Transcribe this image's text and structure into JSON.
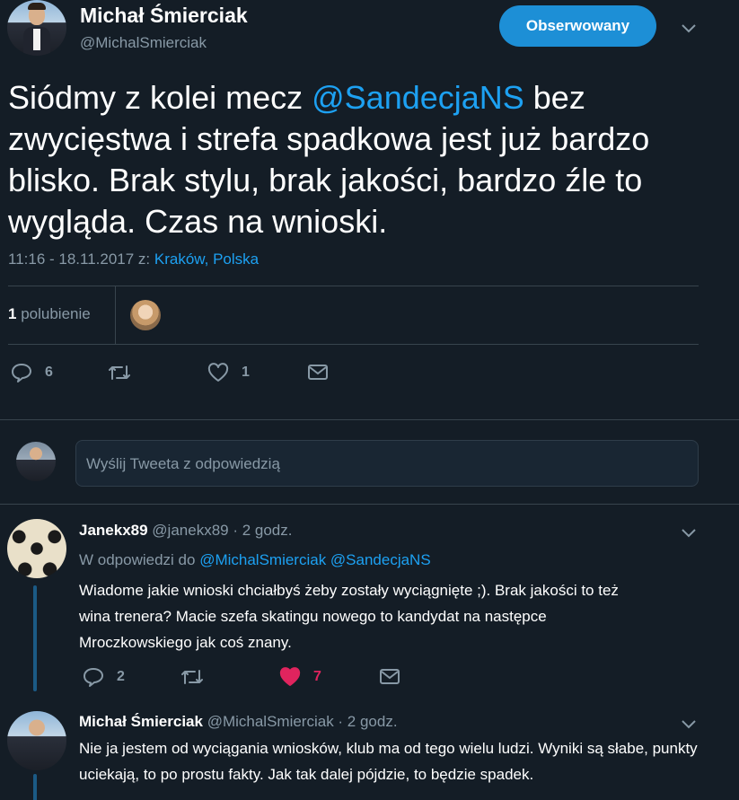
{
  "main_tweet": {
    "author_name": "Michał Śmierciak",
    "author_handle": "@MichalSmierciak",
    "follow_label": "Obserwowany",
    "text_before": "Siódmy z kolei mecz ",
    "mention": "@SandecjaNS",
    "text_after": " bez zwycięstwa i strefa spadkowa jest już bardzo blisko. Brak stylu, brak jakości, bardzo źle to wygląda. Czas na wnioski.",
    "timestamp": "11:16 - 18.11.2017 z: ",
    "location": "Kraków, Polska",
    "likes_number": "1",
    "likes_label": " polubienie",
    "actions": {
      "replies": "6",
      "retweets": "",
      "likes": "1"
    }
  },
  "composer": {
    "placeholder": "Wyślij Tweeta z odpowiedzią"
  },
  "replies": [
    {
      "author_name": "Janekx89",
      "meta": " @janekx89 · 2 godz.",
      "in_reply_prefix": "W odpowiedzi do ",
      "in_reply_mentions": "@MichalSmierciak @SandecjaNS",
      "text": "Wiadome jakie wnioski chciałbyś żeby zostały wyciągnięte ;). Brak jakości to też wina trenera? Macie szefa skatingu nowego to kandydat na następce Mroczkowskiego jak coś znany.",
      "reply_count": "2",
      "like_count": "7",
      "liked": true
    },
    {
      "author_name": "Michał Śmierciak",
      "meta": " @MichalSmierciak · 2 godz.",
      "text": "Nie ja jestem od wyciągania wniosków, klub ma od tego wielu ludzi. Wyniki są słabe, punkty uciekają, to po prostu fakty. Jak tak dalej pójdzie, to będzie spadek."
    }
  ],
  "colors": {
    "background": "#141d26",
    "accent": "#1da1f2",
    "muted": "#8899a6",
    "like": "#e0245e",
    "divider": "#38444d"
  },
  "icons": [
    "reply-icon",
    "retweet-icon",
    "heart-icon",
    "mail-icon",
    "chevron-down-icon"
  ]
}
